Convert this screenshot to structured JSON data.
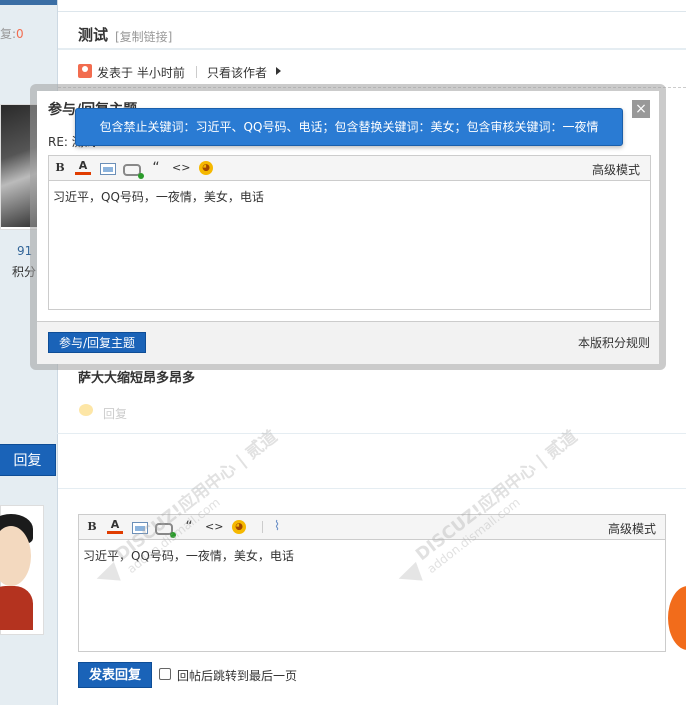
{
  "left": {
    "reply_label": "复:",
    "reply_count": "0",
    "stat_value": "91",
    "stat_label": "积分",
    "big_reply_button": "回复"
  },
  "thread": {
    "title": "测试",
    "copy_link": "[复制链接]",
    "posted_at": "发表于 半小时前",
    "only_author": "只看该作者",
    "post_content": "萨大大缩短昂多昂多",
    "reply_link": "回复"
  },
  "dialog": {
    "title": "参与/回复主题",
    "re_label": "RE: 测试",
    "toolbar": {
      "bold": "B",
      "font_color": "A",
      "quote": "“",
      "code": "<>",
      "advanced_mode": "高级模式"
    },
    "editor_text": "习近平，QQ号码，一夜情，美女，电话",
    "submit": "参与/回复主题",
    "rules": "本版积分规则",
    "close": "×"
  },
  "tooltip": {
    "text": "包含禁止关键词：习近平、QQ号码、电话；包含替换关键词：美女；包含审核关键词：一夜情"
  },
  "bottom_editor": {
    "toolbar": {
      "bold": "B",
      "font_color": "A",
      "quote": "“",
      "code": "<>",
      "advanced_mode": "高级模式"
    },
    "editor_text": "习近平，QQ号码，一夜情，美女，电话",
    "submit": "发表回复",
    "jump_label": "回帖后跳转到最后一页"
  },
  "watermark": {
    "line1": "DISCUZ!应用中心 | 贰道",
    "line2": "addon.dismall.com"
  },
  "colors": {
    "accent_blue": "#1a63b8",
    "tooltip_blue": "#2a7bd3",
    "orange": "#f26c4f",
    "side_bg": "#e5edf2"
  }
}
